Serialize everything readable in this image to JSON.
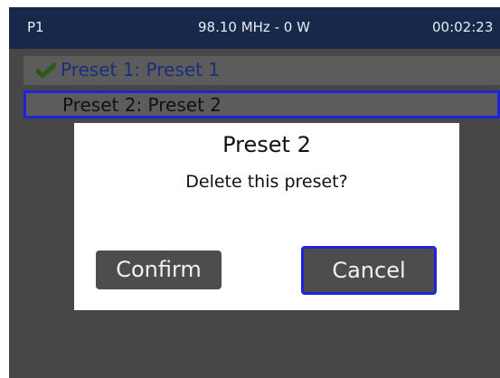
{
  "status": {
    "preset_id": "P1",
    "frequency_power": "98.10 MHz - 0 W",
    "time": "00:02:23"
  },
  "presets": [
    {
      "label": "Preset 1: Preset 1",
      "active": true,
      "icon": "check-icon"
    },
    {
      "label": "Preset 2: Preset 2",
      "selected": true
    }
  ],
  "dialog": {
    "title": "Preset 2",
    "message": "Delete this preset?",
    "confirm_label": "Confirm",
    "cancel_label": "Cancel"
  },
  "colors": {
    "status_bar": "#16294b",
    "background": "#474747",
    "row": "#5c5c5c",
    "focus_border": "#1f23d9",
    "check": "#2d5a1a",
    "active_text": "#1c2d7a"
  }
}
